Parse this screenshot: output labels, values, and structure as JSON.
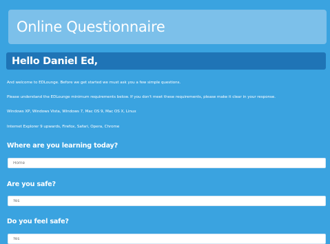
{
  "header": {
    "title": "Online Questionnaire"
  },
  "greeting": {
    "text": "Hello Daniel Ed,"
  },
  "intro": {
    "lines": [
      "And welcome to EDLounge. Before we get started we must ask you a few simple questions.",
      "Please understand the EDLounge minimum requirements below. If you don't meet these requirements, please make it clear in your response.",
      "Windows XP, Windows Vista, Windows 7, Mac OS 9, Mac OS X, Linux",
      "Internet Explorer 9 upwards, Firefox, Safari, Opera, Chrome"
    ]
  },
  "questions": [
    {
      "label": "Where are you learning today?",
      "value": "Home"
    },
    {
      "label": "Are you safe?",
      "value": "Yes"
    },
    {
      "label": "Do you feel safe?",
      "value": "Yes"
    }
  ],
  "colors": {
    "background": "#3aa3e0",
    "title_banner": "#7cc0ea",
    "greeting_bar": "#1f74b6"
  }
}
